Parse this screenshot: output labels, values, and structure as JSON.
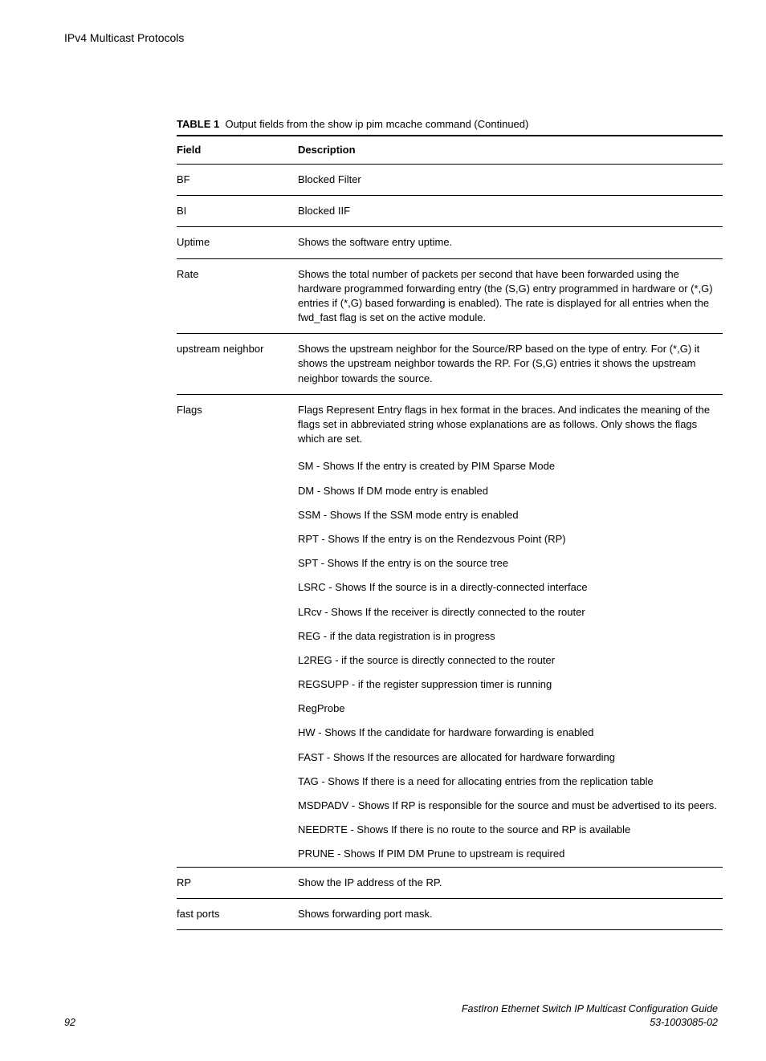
{
  "header": {
    "running": "IPv4 Multicast Protocols"
  },
  "tableCaption": {
    "label": "TABLE 1",
    "text": "Output fields from the show ip pim mcache command (Continued)"
  },
  "columns": {
    "field": "Field",
    "desc": "Description"
  },
  "rows": {
    "bf": {
      "field": "BF",
      "desc": "Blocked Filter"
    },
    "bi": {
      "field": "BI",
      "desc": "Blocked IIF"
    },
    "uptime": {
      "field": "Uptime",
      "desc": "Shows the software entry uptime."
    },
    "rate": {
      "field": "Rate",
      "desc": "Shows the total number of packets per second that have been forwarded using the hardware programmed forwarding entry (the (S,G) entry programmed in hardware or (*,G) entries if (*,G) based forwarding is enabled). The rate is displayed for all entries when the fwd_fast flag is set on the active module."
    },
    "upnbr": {
      "field": "upstream neighbor",
      "desc": "Shows the upstream neighbor for the Source/RP based on the type of entry. For (*,G) it shows the upstream neighbor towards the RP. For (S,G) entries it shows the upstream neighbor towards the source."
    },
    "flags": {
      "field": "Flags",
      "desc": "Flags Represent Entry flags in hex format in the braces. And indicates the meaning of the flags set in abbreviated string whose explanations are as follows. Only shows the flags which are set.",
      "sub": [
        "SM - Shows If the entry is created by PIM Sparse Mode",
        "DM - Shows If DM mode entry is enabled",
        "SSM - Shows If the SSM mode entry is enabled",
        "RPT - Shows If the entry is on the Rendezvous Point (RP)",
        "SPT - Shows If the entry is on the source tree",
        "LSRC - Shows If the source is in a directly-connected interface",
        "LRcv - Shows If the receiver is directly connected to the router",
        "REG - if the data registration is in progress",
        "L2REG - if the source is directly connected to the router",
        "REGSUPP - if the register suppression timer is running",
        "RegProbe",
        "HW - Shows If the candidate for hardware forwarding is enabled",
        "FAST - Shows If the resources are allocated for hardware forwarding",
        "TAG - Shows If there is a need for allocating entries from the replication table",
        "MSDPADV - Shows If RP is responsible for the source and must be advertised to its peers.",
        "NEEDRTE - Shows If there is no route to the source and RP is available",
        "PRUNE - Shows If PIM DM Prune to upstream is required"
      ]
    },
    "rp": {
      "field": "RP",
      "desc": "Show the IP address of the RP."
    },
    "fastports": {
      "field": "fast ports",
      "desc": "Shows forwarding port mask."
    }
  },
  "footer": {
    "page": "92",
    "title": "FastIron Ethernet Switch IP Multicast Configuration Guide",
    "docnum": "53-1003085-02"
  }
}
